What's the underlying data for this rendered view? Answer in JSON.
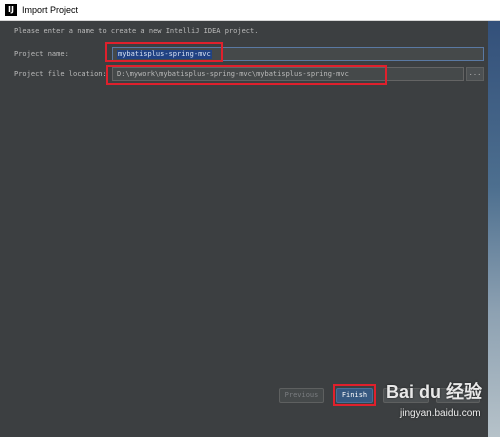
{
  "window": {
    "title": "Import Project",
    "app_icon_glyph": "IJ"
  },
  "intro": "Please enter a name to create a new IntelliJ IDEA project.",
  "project_name": {
    "label": "Project name:",
    "value": "mybatisplus-spring-mvc"
  },
  "project_location": {
    "label": "Project file location:",
    "value": "D:\\mywork\\mybatisplus-spring-mvc\\mybatisplus-spring-mvc",
    "browse_label": "..."
  },
  "buttons": {
    "previous": "Previous",
    "finish": "Finish"
  },
  "watermark": {
    "logo": "Bai du 经验",
    "site": "jingyan.baidu.com"
  },
  "colors": {
    "background": "#3c3f41",
    "highlight": "#e0202c",
    "selection": "#214283",
    "default_button": "#365880"
  }
}
